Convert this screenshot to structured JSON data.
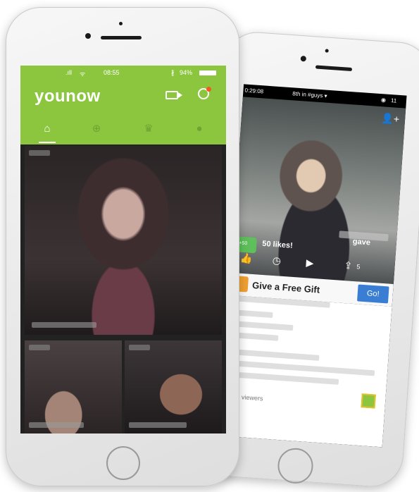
{
  "front_phone": {
    "status_bar": {
      "signal": ".ıll",
      "wifi": "ᯤ",
      "time": "08:55",
      "bluetooth": "∦",
      "battery": "94%"
    },
    "header": {
      "logo": "younow",
      "icons": [
        "camera-icon",
        "search-icon"
      ]
    },
    "tabs": [
      {
        "name": "home-icon",
        "active": true
      },
      {
        "name": "plus-icon",
        "active": false
      },
      {
        "name": "crown-icon",
        "active": false
      },
      {
        "name": "profile-icon",
        "active": false
      }
    ],
    "accent_color": "#8cc63f",
    "notification_color": "#f15a24"
  },
  "back_phone": {
    "top_bar": {
      "timer": "0:29:08",
      "rank": "8th in #guys",
      "viewer_count": "11"
    },
    "likes_badge": "+50",
    "likes_text": "50 likes!",
    "gave_text": "gave",
    "share_count": "5",
    "gift_banner": {
      "text": "Give a Free Gift",
      "button": "Go!"
    },
    "viewers_text": "th 11 viewers",
    "button_color": "#3a7ed3"
  }
}
